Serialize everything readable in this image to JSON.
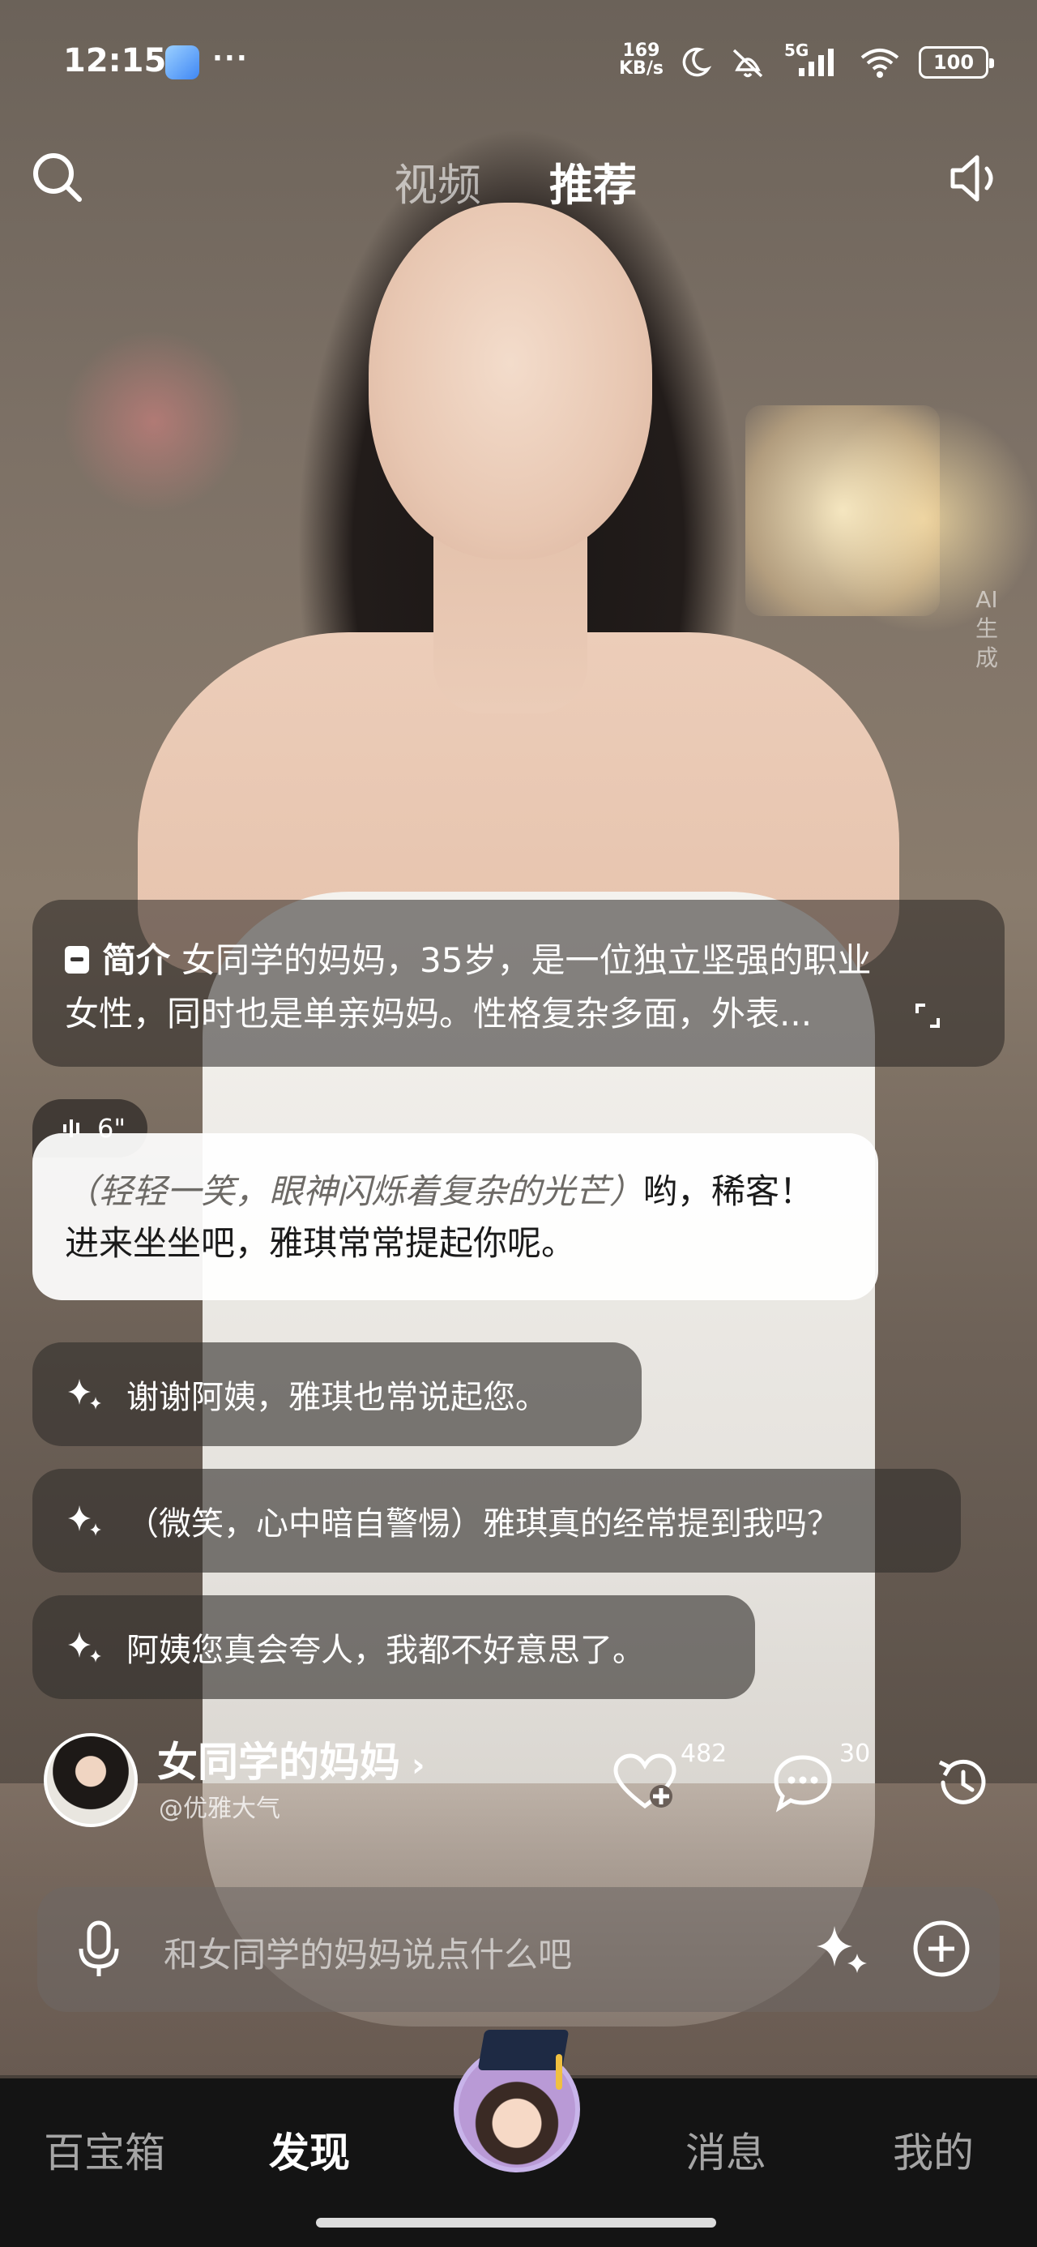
{
  "status_bar": {
    "time": "12:15",
    "overflow": "···",
    "net_speed_value": "169",
    "net_speed_unit": "KB/s",
    "signal_label": "5G",
    "battery": "100"
  },
  "top_nav": {
    "tabs": [
      {
        "label": "视频",
        "active": false
      },
      {
        "label": "推荐",
        "active": true
      }
    ]
  },
  "ai_mark": "AI生成",
  "intro": {
    "label": "简介",
    "text_line1": "女同学的妈妈，35岁，是一位独立坚强的职业",
    "text_line2": "女性，同时也是单亲妈妈。性格复杂多面，外表..."
  },
  "voice_message": {
    "duration": "6\""
  },
  "message": {
    "action": "（轻轻一笑，眼神闪烁着复杂的光芒）",
    "text_line1_tail": "哟，稀客！",
    "text_line2": "进来坐坐吧，雅琪常常提起你呢。"
  },
  "suggestions": [
    "谢谢阿姨，雅琪也常说起您。",
    "（微笑，心中暗自警惕）雅琪真的经常提到我吗？",
    "阿姨您真会夸人，我都不好意思了。"
  ],
  "character": {
    "name": "女同学的妈妈",
    "chevron": "›",
    "handle": "@优雅大气",
    "likes": "482",
    "comments": "30"
  },
  "input": {
    "placeholder": "和女同学的妈妈说点什么吧"
  },
  "bottom_nav": {
    "items": [
      {
        "label": "百宝箱",
        "active": false
      },
      {
        "label": "发现",
        "active": true
      },
      {
        "label": "消息",
        "active": false
      },
      {
        "label": "我的",
        "active": false
      }
    ]
  },
  "colors": {
    "card_bg": "#2a2522",
    "bubble_bg": "#ffffff",
    "nav_bg": "#141414"
  }
}
